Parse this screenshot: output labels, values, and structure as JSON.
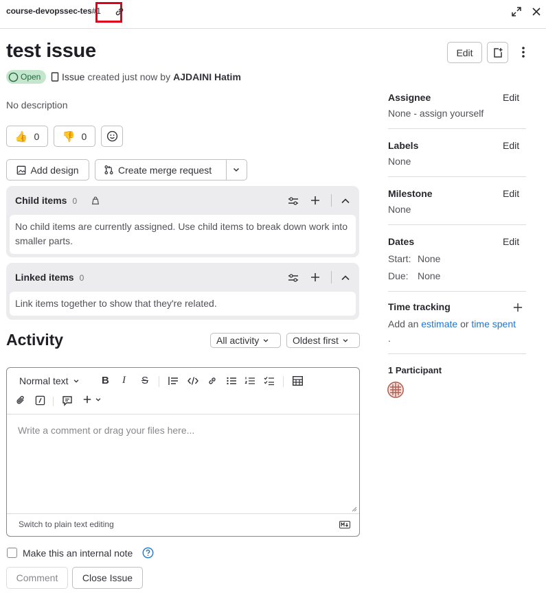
{
  "header": {
    "project": "course-devopssec-tes",
    "ref": "#1"
  },
  "issue": {
    "title": "test issue",
    "status": "Open",
    "type": "Issue",
    "created_text": "created just now by",
    "author": "AJDAINI Hatim",
    "description": "No description",
    "edit_label": "Edit"
  },
  "reactions": {
    "thumbs_up": "0",
    "thumbs_down": "0"
  },
  "actions": {
    "add_design": "Add design",
    "create_mr": "Create merge request"
  },
  "child_items": {
    "title": "Child items",
    "count": "0",
    "empty": "No child items are currently assigned. Use child items to break down work into smaller parts."
  },
  "linked_items": {
    "title": "Linked items",
    "count": "0",
    "empty": "Link items together to show that they're related."
  },
  "activity": {
    "title": "Activity",
    "filter": "All activity",
    "sort": "Oldest first"
  },
  "editor": {
    "text_style": "Normal text",
    "placeholder": "Write a comment or drag your files here...",
    "switch_mode": "Switch to plain text editing",
    "internal_note": "Make this an internal note",
    "comment_btn": "Comment",
    "close_btn": "Close Issue"
  },
  "sidebar": {
    "assignee_label": "Assignee",
    "assignee_value": "None - assign yourself",
    "labels_label": "Labels",
    "labels_value": "None",
    "milestone_label": "Milestone",
    "milestone_value": "None",
    "dates_label": "Dates",
    "start_label": "Start:",
    "start_value": "None",
    "due_label": "Due:",
    "due_value": "None",
    "time_label": "Time tracking",
    "time_prefix": "Add an",
    "time_estimate": "estimate",
    "time_or": "or",
    "time_spent": "time spent",
    "time_dot": ".",
    "participants": "1 Participant",
    "edit": "Edit"
  },
  "colors": {
    "accent": "#1f75cb",
    "open_badge_bg": "#c3e6cd",
    "open_badge_fg": "#24663b",
    "highlight": "#e0001a"
  }
}
